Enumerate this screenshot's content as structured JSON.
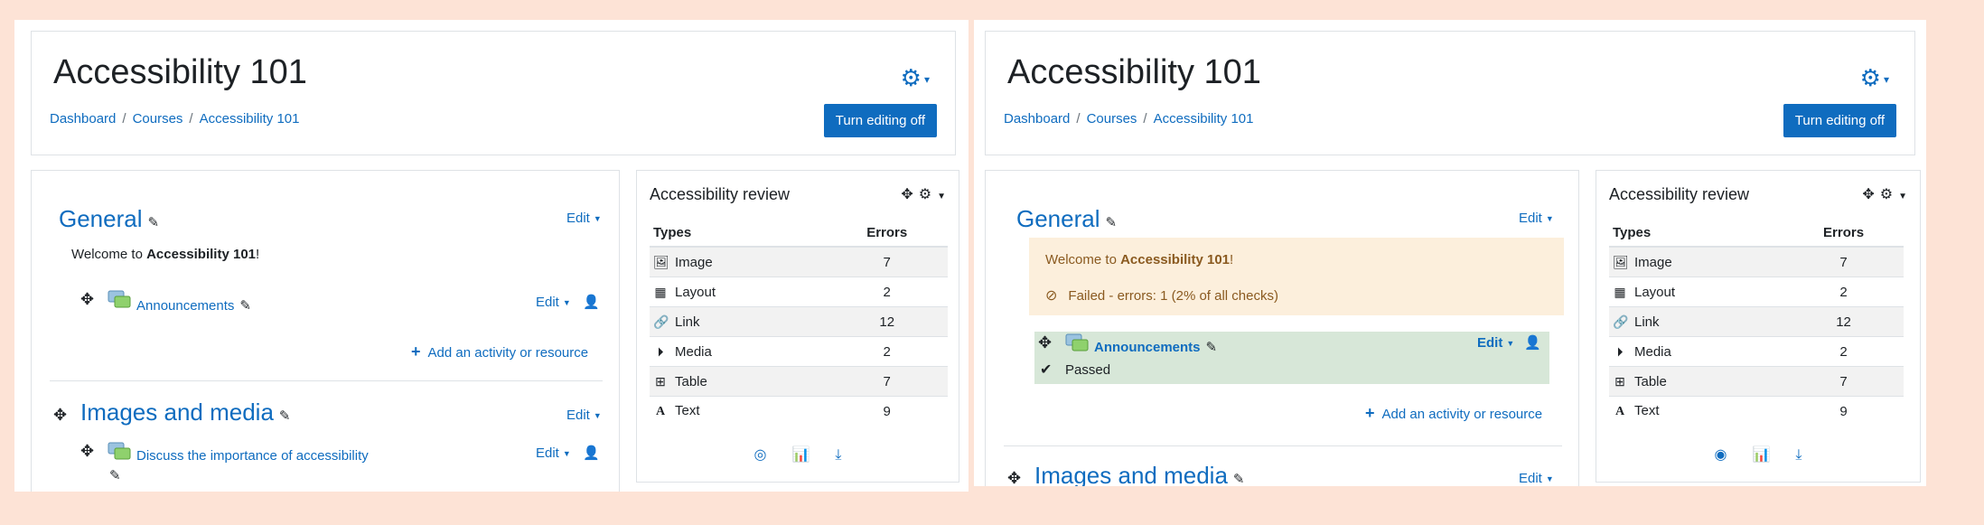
{
  "page": {
    "title": "Accessibility 101",
    "breadcrumb": [
      "Dashboard",
      "Courses",
      "Accessibility 101"
    ],
    "editing_button": "Turn editing off"
  },
  "course": {
    "general_title": "General",
    "edit_label": "Edit",
    "welcome_prefix": "Welcome to ",
    "welcome_course": "Accessibility 101",
    "welcome_suffix": "!",
    "announcements": "Announcements",
    "add_activity": "Add an activity or resource",
    "images_media_title": "Images and media",
    "discuss": "Discuss the importance of accessibility",
    "failed_status": "Failed - errors: 1 (2% of all checks)",
    "passed_status": "Passed"
  },
  "review_block": {
    "title": "Accessibility review",
    "col_types": "Types",
    "col_errors": "Errors",
    "rows": [
      {
        "type": "Image",
        "errors": "7",
        "icon": "image-icon"
      },
      {
        "type": "Layout",
        "errors": "2",
        "icon": "layout-icon"
      },
      {
        "type": "Link",
        "errors": "12",
        "icon": "link-icon"
      },
      {
        "type": "Media",
        "errors": "2",
        "icon": "media-icon"
      },
      {
        "type": "Table",
        "errors": "7",
        "icon": "table-icon"
      },
      {
        "type": "Text",
        "errors": "9",
        "icon": "text-icon"
      }
    ]
  },
  "colors": {
    "primary": "#0f6cbf",
    "page_background": "#fde3d6",
    "failed_background": "#fcefdc",
    "passed_background": "#d7e7d8"
  }
}
